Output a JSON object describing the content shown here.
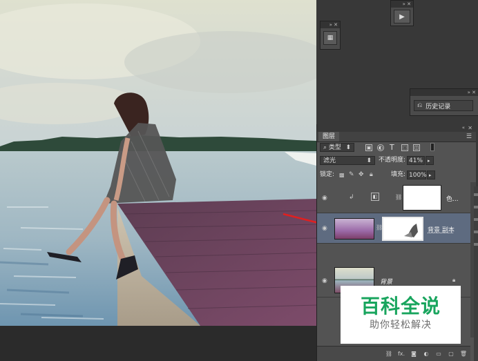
{
  "panels": {
    "history_label": "历史记录"
  },
  "layers": {
    "tab_title": "图层",
    "filter_kind": "类型",
    "blend_mode": "滤光",
    "opacity_label": "不透明度:",
    "opacity_value": "41%",
    "lock_label": "锁定:",
    "fill_label": "填充:",
    "fill_value": "100%",
    "items": [
      {
        "name": "色...",
        "visible": true,
        "active": false
      },
      {
        "name": "背景 副本",
        "visible": true,
        "active": true
      },
      {
        "name": "背景",
        "visible": true,
        "active": false,
        "locked": true
      }
    ],
    "footer_fx": "fx."
  },
  "watermark": {
    "title": "百科全说",
    "subtitle": "助你轻松解决"
  },
  "colors": {
    "active_layer": "#5e6b80",
    "watermark_green": "#19a55e",
    "arrow_red": "#e02020"
  }
}
